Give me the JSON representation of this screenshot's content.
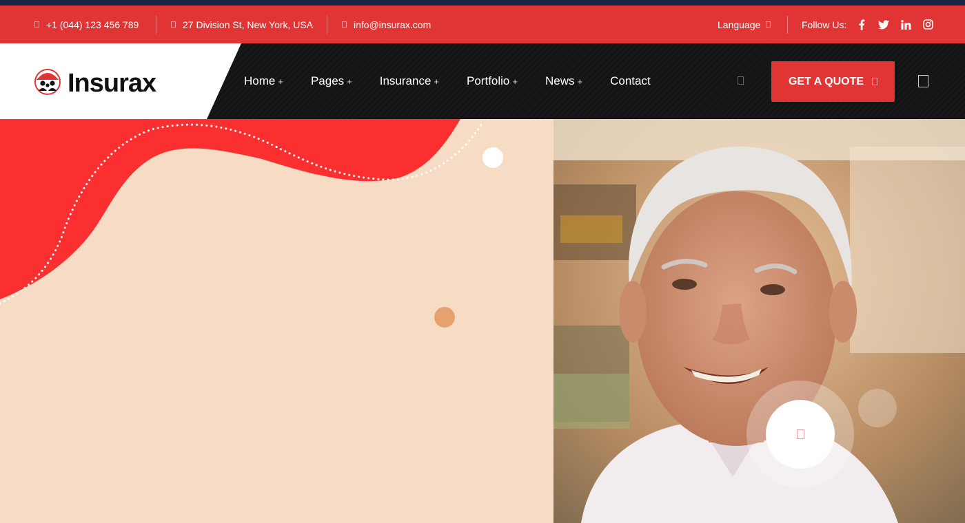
{
  "topbar": {
    "phone": "+1 (044) 123 456 789",
    "address": "27 Division St, New York, USA",
    "email": "info@insurax.com",
    "language_label": "Language",
    "follow_label": "Follow Us:",
    "social_icons": [
      "facebook-icon",
      "twitter-icon",
      "linkedin-icon",
      "instagram-icon"
    ]
  },
  "header": {
    "logo_text": "Insurax",
    "nav": [
      {
        "label": "Home",
        "plus": "+"
      },
      {
        "label": "Pages",
        "plus": "+"
      },
      {
        "label": "Insurance",
        "plus": "+"
      },
      {
        "label": "Portfolio",
        "plus": "+"
      },
      {
        "label": "News",
        "plus": "+"
      },
      {
        "label": "Contact",
        "plus": ""
      }
    ],
    "cta_label": "GET A QUOTE"
  },
  "colors": {
    "top_line": "#162446",
    "accent_red": "#e13535",
    "hero_red": "#fb2e30",
    "peach": "#f6dcc5",
    "dot_orange": "#e6a26e",
    "header_dark": "#141414"
  }
}
